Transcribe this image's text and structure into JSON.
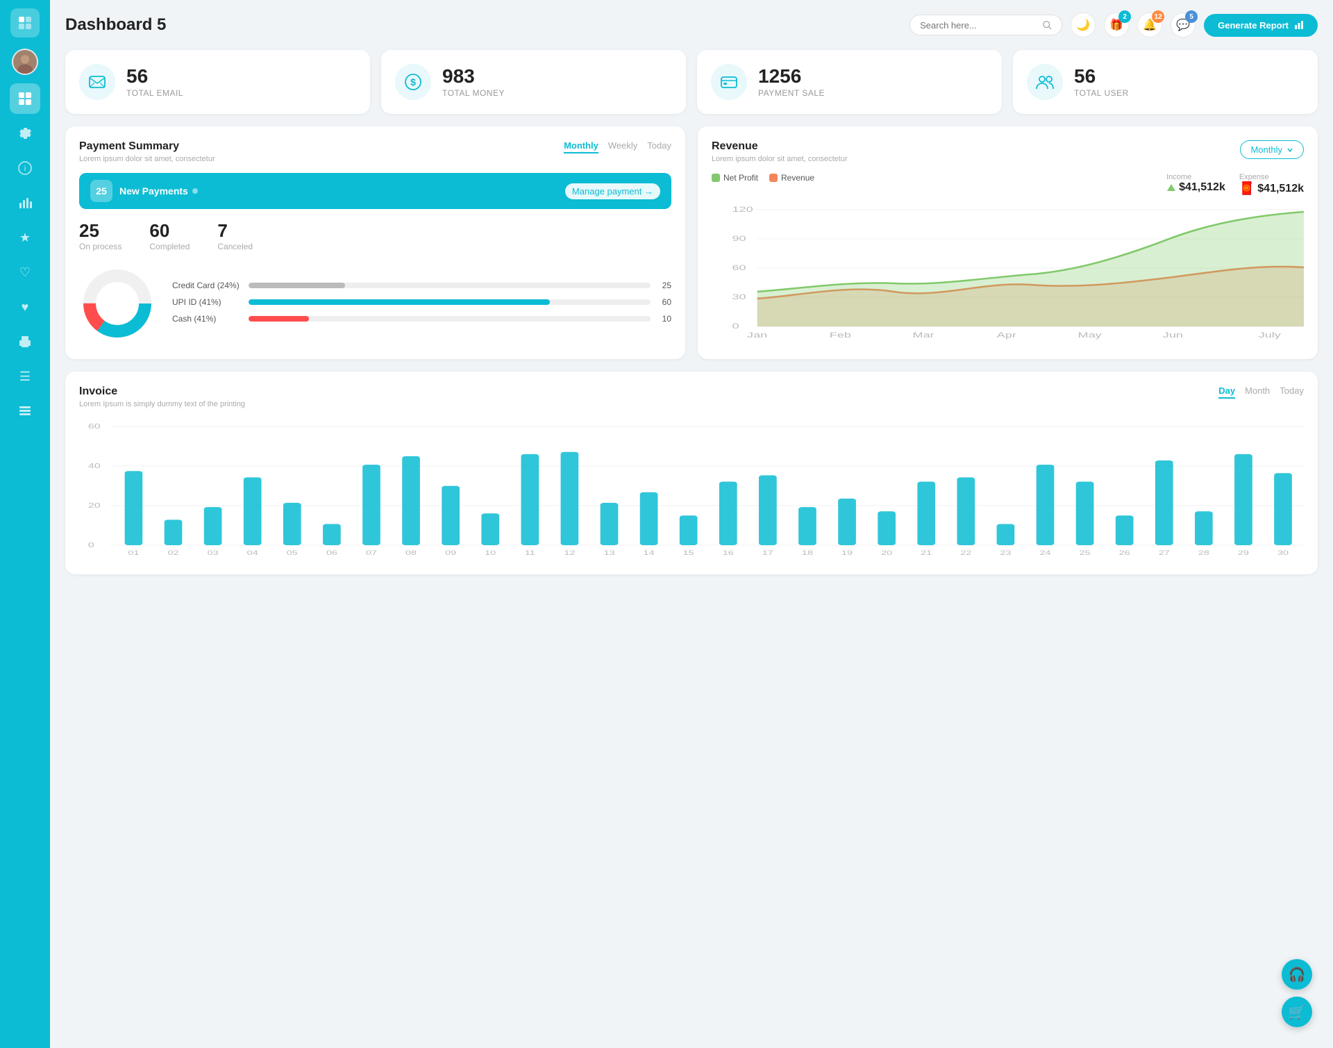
{
  "header": {
    "title": "Dashboard 5",
    "search_placeholder": "Search here...",
    "generate_btn": "Generate Report",
    "badges": {
      "gift": "2",
      "bell": "12",
      "chat": "5"
    }
  },
  "stat_cards": [
    {
      "id": "total-email",
      "icon": "📋",
      "value": "56",
      "label": "TOTAL EMAIL"
    },
    {
      "id": "total-money",
      "icon": "💲",
      "value": "983",
      "label": "TOTAL MONEY"
    },
    {
      "id": "payment-sale",
      "icon": "💳",
      "value": "1256",
      "label": "PAYMENT SALE"
    },
    {
      "id": "total-user",
      "icon": "👥",
      "value": "56",
      "label": "TOTAL USER"
    }
  ],
  "payment_summary": {
    "title": "Payment Summary",
    "subtitle": "Lorem ipsum dolor sit amet, consectetur",
    "tabs": [
      "Monthly",
      "Weekly",
      "Today"
    ],
    "active_tab": "Monthly",
    "new_payments_count": "25",
    "new_payments_label": "New Payments",
    "manage_link": "Manage payment →",
    "stats": [
      {
        "value": "25",
        "label": "On process"
      },
      {
        "value": "60",
        "label": "Completed"
      },
      {
        "value": "7",
        "label": "Canceled"
      }
    ],
    "bars": [
      {
        "label": "Credit Card (24%)",
        "pct": 24,
        "color": "#bbb",
        "value": "25"
      },
      {
        "label": "UPI ID (41%)",
        "pct": 75,
        "color": "#0bbcd4",
        "value": "60"
      },
      {
        "label": "Cash (41%)",
        "pct": 15,
        "color": "#ff4d4d",
        "value": "10"
      }
    ],
    "donut": {
      "segments": [
        {
          "label": "Completed",
          "pct": 60,
          "color": "#0bbcd4"
        },
        {
          "label": "On process",
          "pct": 25,
          "color": "#f0f0f0"
        },
        {
          "label": "Canceled",
          "pct": 15,
          "color": "#ff4d4d"
        }
      ]
    }
  },
  "revenue": {
    "title": "Revenue",
    "subtitle": "Lorem ipsum dolor sit amet, consectetur",
    "tab_active": "Monthly",
    "tabs": [
      "Monthly"
    ],
    "income": {
      "label": "Income",
      "value": "$41,512k"
    },
    "expense": {
      "label": "Expense",
      "value": "$41,512k"
    },
    "legend": [
      {
        "label": "Net Profit",
        "color": "#82c96b"
      },
      {
        "label": "Revenue",
        "color": "#f4855a"
      }
    ],
    "months": [
      "Jan",
      "Feb",
      "Mar",
      "Apr",
      "May",
      "Jun",
      "July"
    ],
    "y_labels": [
      "0",
      "30",
      "60",
      "90",
      "120"
    ]
  },
  "invoice": {
    "title": "Invoice",
    "subtitle": "Lorem Ipsum is simply dummy text of the printing",
    "tabs": [
      "Day",
      "Month",
      "Today"
    ],
    "active_tab": "Day",
    "y_labels": [
      "0",
      "20",
      "40",
      "60"
    ],
    "x_labels": [
      "01",
      "02",
      "03",
      "04",
      "05",
      "06",
      "07",
      "08",
      "09",
      "10",
      "11",
      "12",
      "13",
      "14",
      "15",
      "16",
      "17",
      "18",
      "19",
      "20",
      "21",
      "22",
      "23",
      "24",
      "25",
      "26",
      "27",
      "28",
      "29",
      "30"
    ],
    "bar_color": "#0bbcd4",
    "bars": [
      35,
      12,
      18,
      32,
      20,
      10,
      38,
      42,
      28,
      15,
      43,
      44,
      20,
      25,
      14,
      30,
      33,
      18,
      22,
      16,
      30,
      32,
      10,
      38,
      30,
      14,
      40,
      16,
      43,
      34
    ]
  },
  "sidebar": {
    "items": [
      {
        "id": "wallet",
        "icon": "💼",
        "active": false
      },
      {
        "id": "dashboard",
        "icon": "⊞",
        "active": true
      },
      {
        "id": "settings",
        "icon": "⚙",
        "active": false
      },
      {
        "id": "info",
        "icon": "ℹ",
        "active": false
      },
      {
        "id": "chart",
        "icon": "📊",
        "active": false
      },
      {
        "id": "star",
        "icon": "★",
        "active": false
      },
      {
        "id": "heart-outline",
        "icon": "♡",
        "active": false
      },
      {
        "id": "heart-fill",
        "icon": "♥",
        "active": false
      },
      {
        "id": "print",
        "icon": "🖨",
        "active": false
      },
      {
        "id": "menu",
        "icon": "☰",
        "active": false
      },
      {
        "id": "list",
        "icon": "📄",
        "active": false
      }
    ]
  }
}
